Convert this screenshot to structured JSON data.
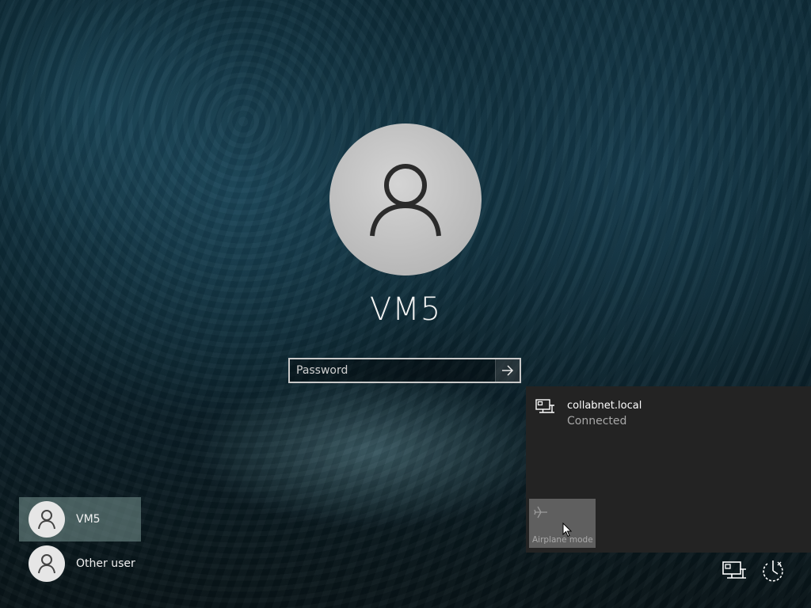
{
  "window": {
    "title": "Windows lock screen"
  },
  "account": {
    "display_name": "VM5"
  },
  "login": {
    "password_placeholder": "Password",
    "password_value": "",
    "submit_icon": "arrow-right-icon"
  },
  "user_list": [
    {
      "label": "VM5",
      "selected": true,
      "icon": "user-icon"
    },
    {
      "label": "Other user",
      "selected": false,
      "icon": "user-icon"
    }
  ],
  "network_flyout": {
    "network": {
      "name": "collabnet.local",
      "status": "Connected",
      "icon": "ethernet-icon"
    },
    "tiles": [
      {
        "label": "Airplane mode",
        "icon": "airplane-icon",
        "active": false
      }
    ]
  },
  "tray": {
    "network_icon": "ethernet-icon",
    "power_icon": "power-icon"
  },
  "colors": {
    "flyout_bg": "#232323",
    "tile_bg": "#5f5f5f",
    "selected_user_bg": "#789691"
  }
}
